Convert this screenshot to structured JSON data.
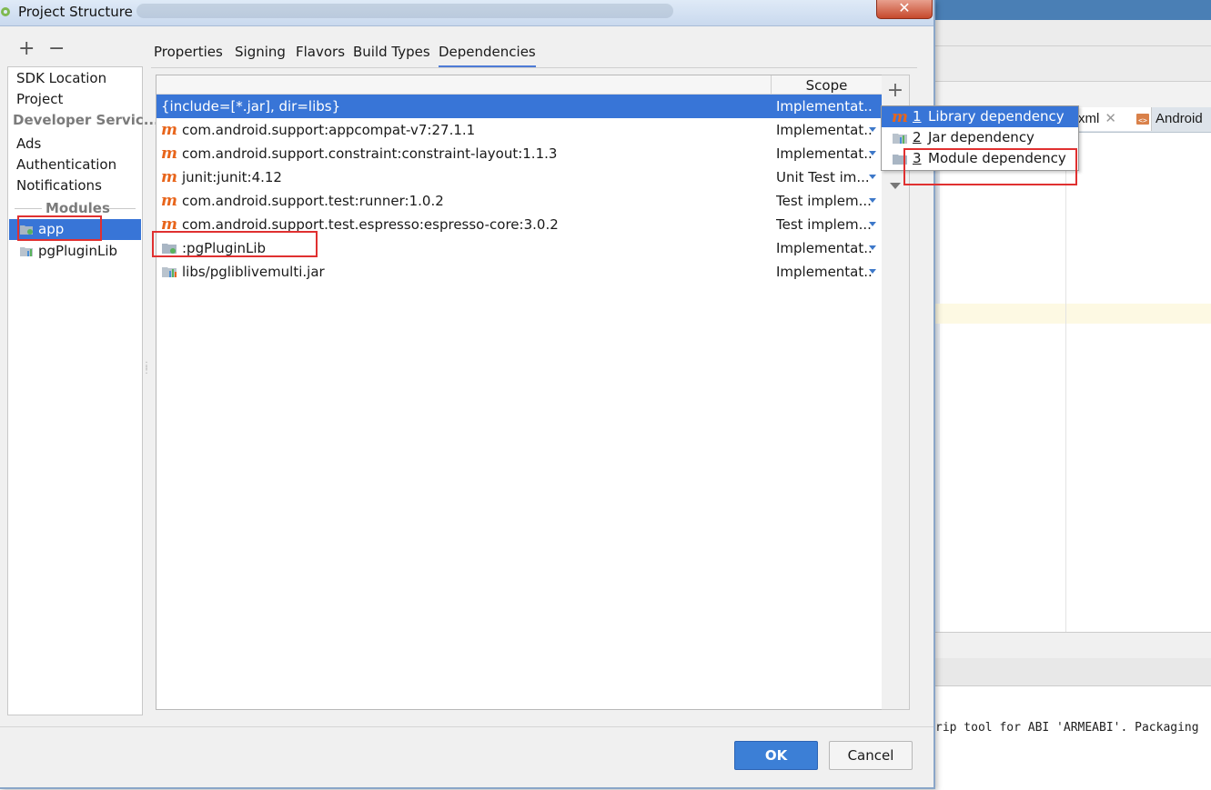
{
  "window": {
    "title": "Project Structure",
    "close_symbol": "✕"
  },
  "left_panel": {
    "add_symbol": "+",
    "remove_symbol": "−",
    "items": [
      "SDK Location",
      "Project"
    ],
    "developer_services_header": "Developer Servic...",
    "developer_services": [
      "Ads",
      "Authentication",
      "Notifications"
    ],
    "modules_header": "Modules",
    "modules": [
      "app",
      "pgPluginLib"
    ]
  },
  "tabs": [
    "Properties",
    "Signing",
    "Flavors",
    "Build Types",
    "Dependencies"
  ],
  "active_tab": "Dependencies",
  "table": {
    "scope_header": "Scope",
    "rows": [
      {
        "icon": "file-tree-icon",
        "name": "{include=[*.jar], dir=libs}",
        "scope": "Implementat..."
      },
      {
        "icon": "maven-icon",
        "name": "com.android.support:appcompat-v7:27.1.1",
        "scope": "Implementat..."
      },
      {
        "icon": "maven-icon",
        "name": "com.android.support.constraint:constraint-layout:1.1.3",
        "scope": "Implementat..."
      },
      {
        "icon": "maven-icon",
        "name": "junit:junit:4.12",
        "scope": "Unit Test im..."
      },
      {
        "icon": "maven-icon",
        "name": "com.android.support.test:runner:1.0.2",
        "scope": "Test implem..."
      },
      {
        "icon": "maven-icon",
        "name": "com.android.support.test.espresso:espresso-core:3.0.2",
        "scope": "Test implem..."
      },
      {
        "icon": "module-folder-icon",
        "name": ":pgPluginLib",
        "scope": "Implementat..."
      },
      {
        "icon": "jar-icon",
        "name": "libs/pgliblivemulti.jar",
        "scope": "Implementat..."
      }
    ]
  },
  "toolbar": {
    "add_symbol": "+"
  },
  "popup_menu": [
    {
      "number": "1",
      "label": "Library dependency"
    },
    {
      "number": "2",
      "label": "Jar dependency"
    },
    {
      "number": "3",
      "label": "Module dependency"
    }
  ],
  "buttons": {
    "ok": "OK",
    "cancel": "Cancel"
  },
  "background": {
    "tab1": "xml",
    "tab1_close": "✕",
    "tab2": "Android",
    "console_text": "rip tool for ABI 'ARMEABI'. Packaging"
  },
  "colors": {
    "selection": "#3875d7",
    "maven": "#e8651b",
    "annotation": "#e03030",
    "ok_button": "#3c7fd6"
  }
}
